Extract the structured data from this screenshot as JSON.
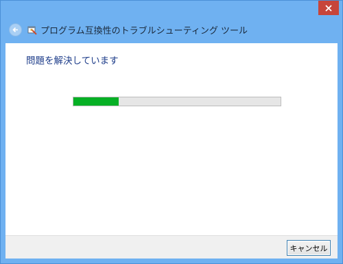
{
  "window": {
    "title": "プログラム互換性のトラブルシューティング ツール"
  },
  "main": {
    "heading": "問題を解決しています",
    "progress_fraction": 0.22
  },
  "footer": {
    "cancel_label": "キャンセル"
  },
  "icons": {
    "close": "close-icon",
    "back": "back-arrow-icon",
    "app": "troubleshooter-app-icon"
  },
  "colors": {
    "title_bar": "#6fb1f1",
    "close_button": "#c7453a",
    "heading_text": "#1e3d8a",
    "progress_fill": "#06b025"
  }
}
